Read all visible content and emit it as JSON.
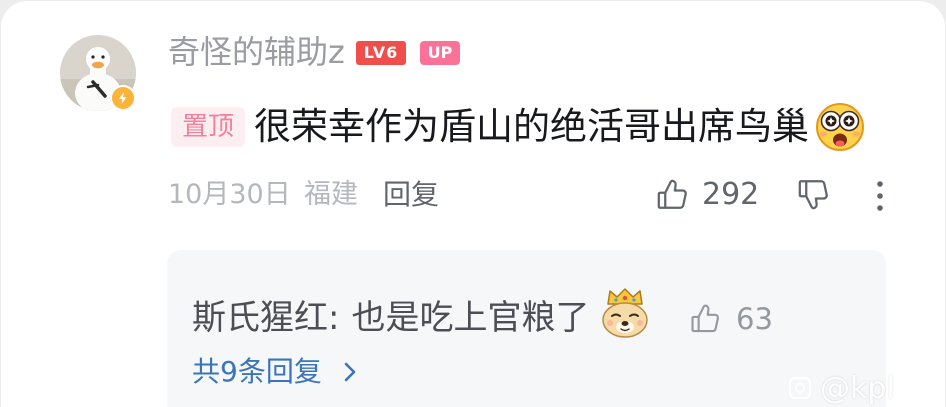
{
  "comment": {
    "author": {
      "name": "奇怪的辅助z",
      "level_badge": "LV6",
      "up_badge": "UP",
      "avatar_icon": "goose-avatar",
      "verified_icon": "lightning-icon"
    },
    "pinned_label": "置顶",
    "text": "很荣幸作为盾山的绝活哥出席鸟巢",
    "emoji_icon": "star-struck-emoji",
    "date": "10月30日",
    "location": "福建",
    "reply_label": "回复",
    "like_count": "292",
    "icons": {
      "like": "thumbs-up-icon",
      "dislike": "thumbs-down-icon",
      "more": "more-vertical-icon"
    }
  },
  "reply_preview": {
    "author": "斯氏猩红",
    "separator": ":",
    "text": "也是吃上官粮了",
    "emoji_icon": "crowned-doge-emoji",
    "like_count": "63",
    "like_icon": "thumbs-up-icon",
    "view_more_label": "共9条回复",
    "view_more_icon": "chevron-right-icon"
  },
  "watermark": "@kpl",
  "colors": {
    "pinned_bg": "#fdeef2",
    "pinned_text": "#f2819c",
    "level_badge": "#f04d4d",
    "up_badge": "#fb7299",
    "link_blue": "#3a74bd",
    "verified_badge": "#fbb33a",
    "reply_box_bg": "#f6f7f8"
  }
}
